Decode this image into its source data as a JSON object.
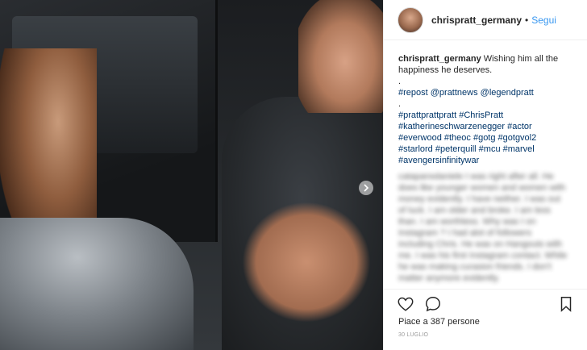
{
  "post": {
    "username": "chrispratt_germany",
    "separator": "•",
    "follow_label": "Segui"
  },
  "caption": {
    "author": "chrispratt_germany",
    "lines": [
      "Wishing him all the happiness he deserves.",
      ".",
      "#repost @prattnews @legendpratt",
      ".",
      "#prattprattpratt #ChrisPratt",
      "#katherineschwarzenegger #actor",
      "#everwood #theoc #gotg #gotgvol2",
      "#starlord #peterquill #mcu #marvel",
      "#avengersinfinitywar"
    ]
  },
  "comments_blurred": [
    "catapansdaniele I was right after all. He",
    "does like younger women and women with",
    "money evidently. I have neither. I was out",
    "of luck. I am older and broke. I am less",
    "than. I am worthless. Why was I on",
    "Instagram ? I had alot of followers",
    "including Chris. He was on Hangouts with",
    "me. I was his first Instagram contact. While",
    "he was making curasion friends. I don't",
    "matter anymore evidently."
  ],
  "footer": {
    "likes": "Piace a 387 persone",
    "date": "30 LUGLIO"
  },
  "icons": {
    "like": "heart-icon",
    "comment": "comment-icon",
    "save": "bookmark-icon",
    "next": "chevron-right-icon"
  },
  "colors": {
    "link": "#3897f0",
    "text": "#262626",
    "muted": "#999999",
    "border": "#efefef"
  }
}
